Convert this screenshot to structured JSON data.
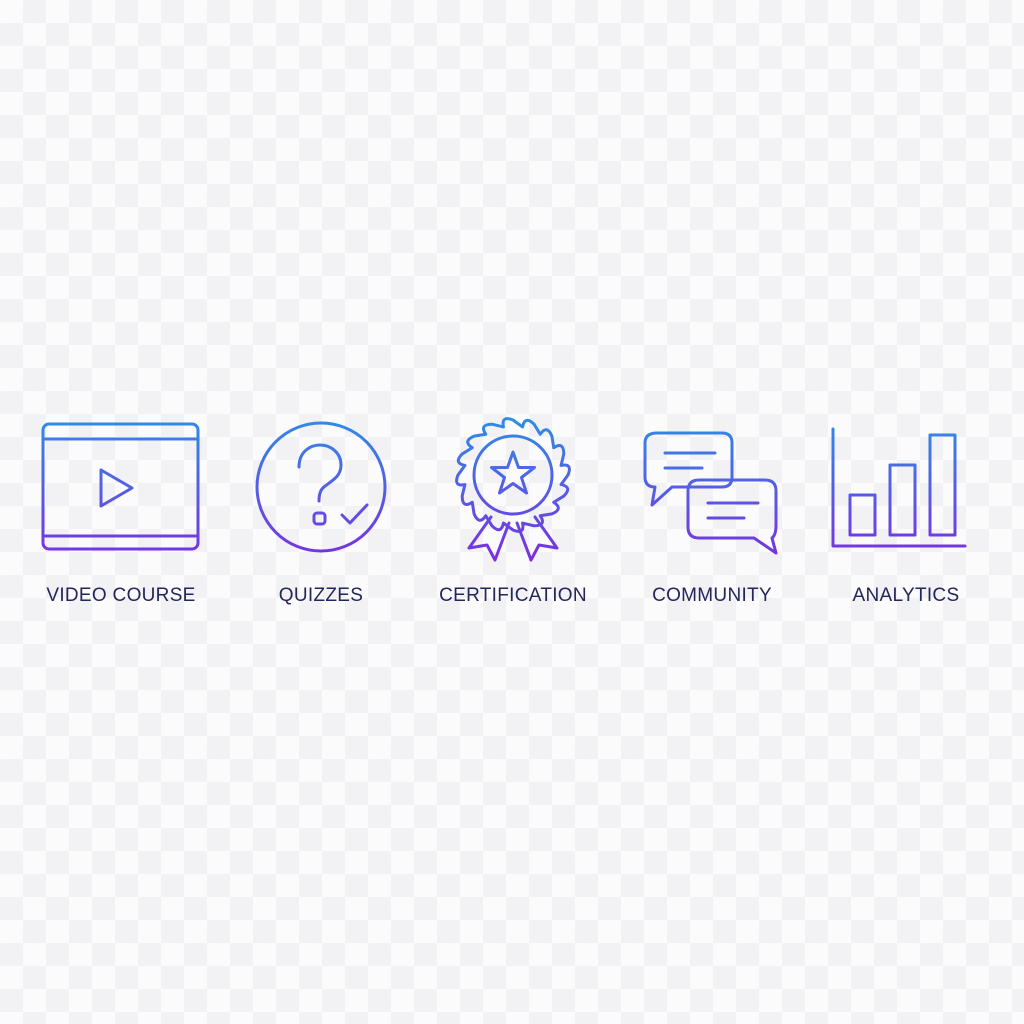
{
  "features": [
    {
      "label": "VIDEO COURSE",
      "icon": "video-player-icon"
    },
    {
      "label": "QUIZZES",
      "icon": "question-check-icon"
    },
    {
      "label": "CERTIFICATION",
      "icon": "award-ribbon-icon"
    },
    {
      "label": "COMMUNITY",
      "icon": "chat-bubbles-icon"
    },
    {
      "label": "ANALYTICS",
      "icon": "bar-chart-icon"
    }
  ],
  "colors": {
    "gradient_top": "#2d8fe6",
    "gradient_bottom": "#7a2fe0",
    "label_text": "#22265a"
  }
}
